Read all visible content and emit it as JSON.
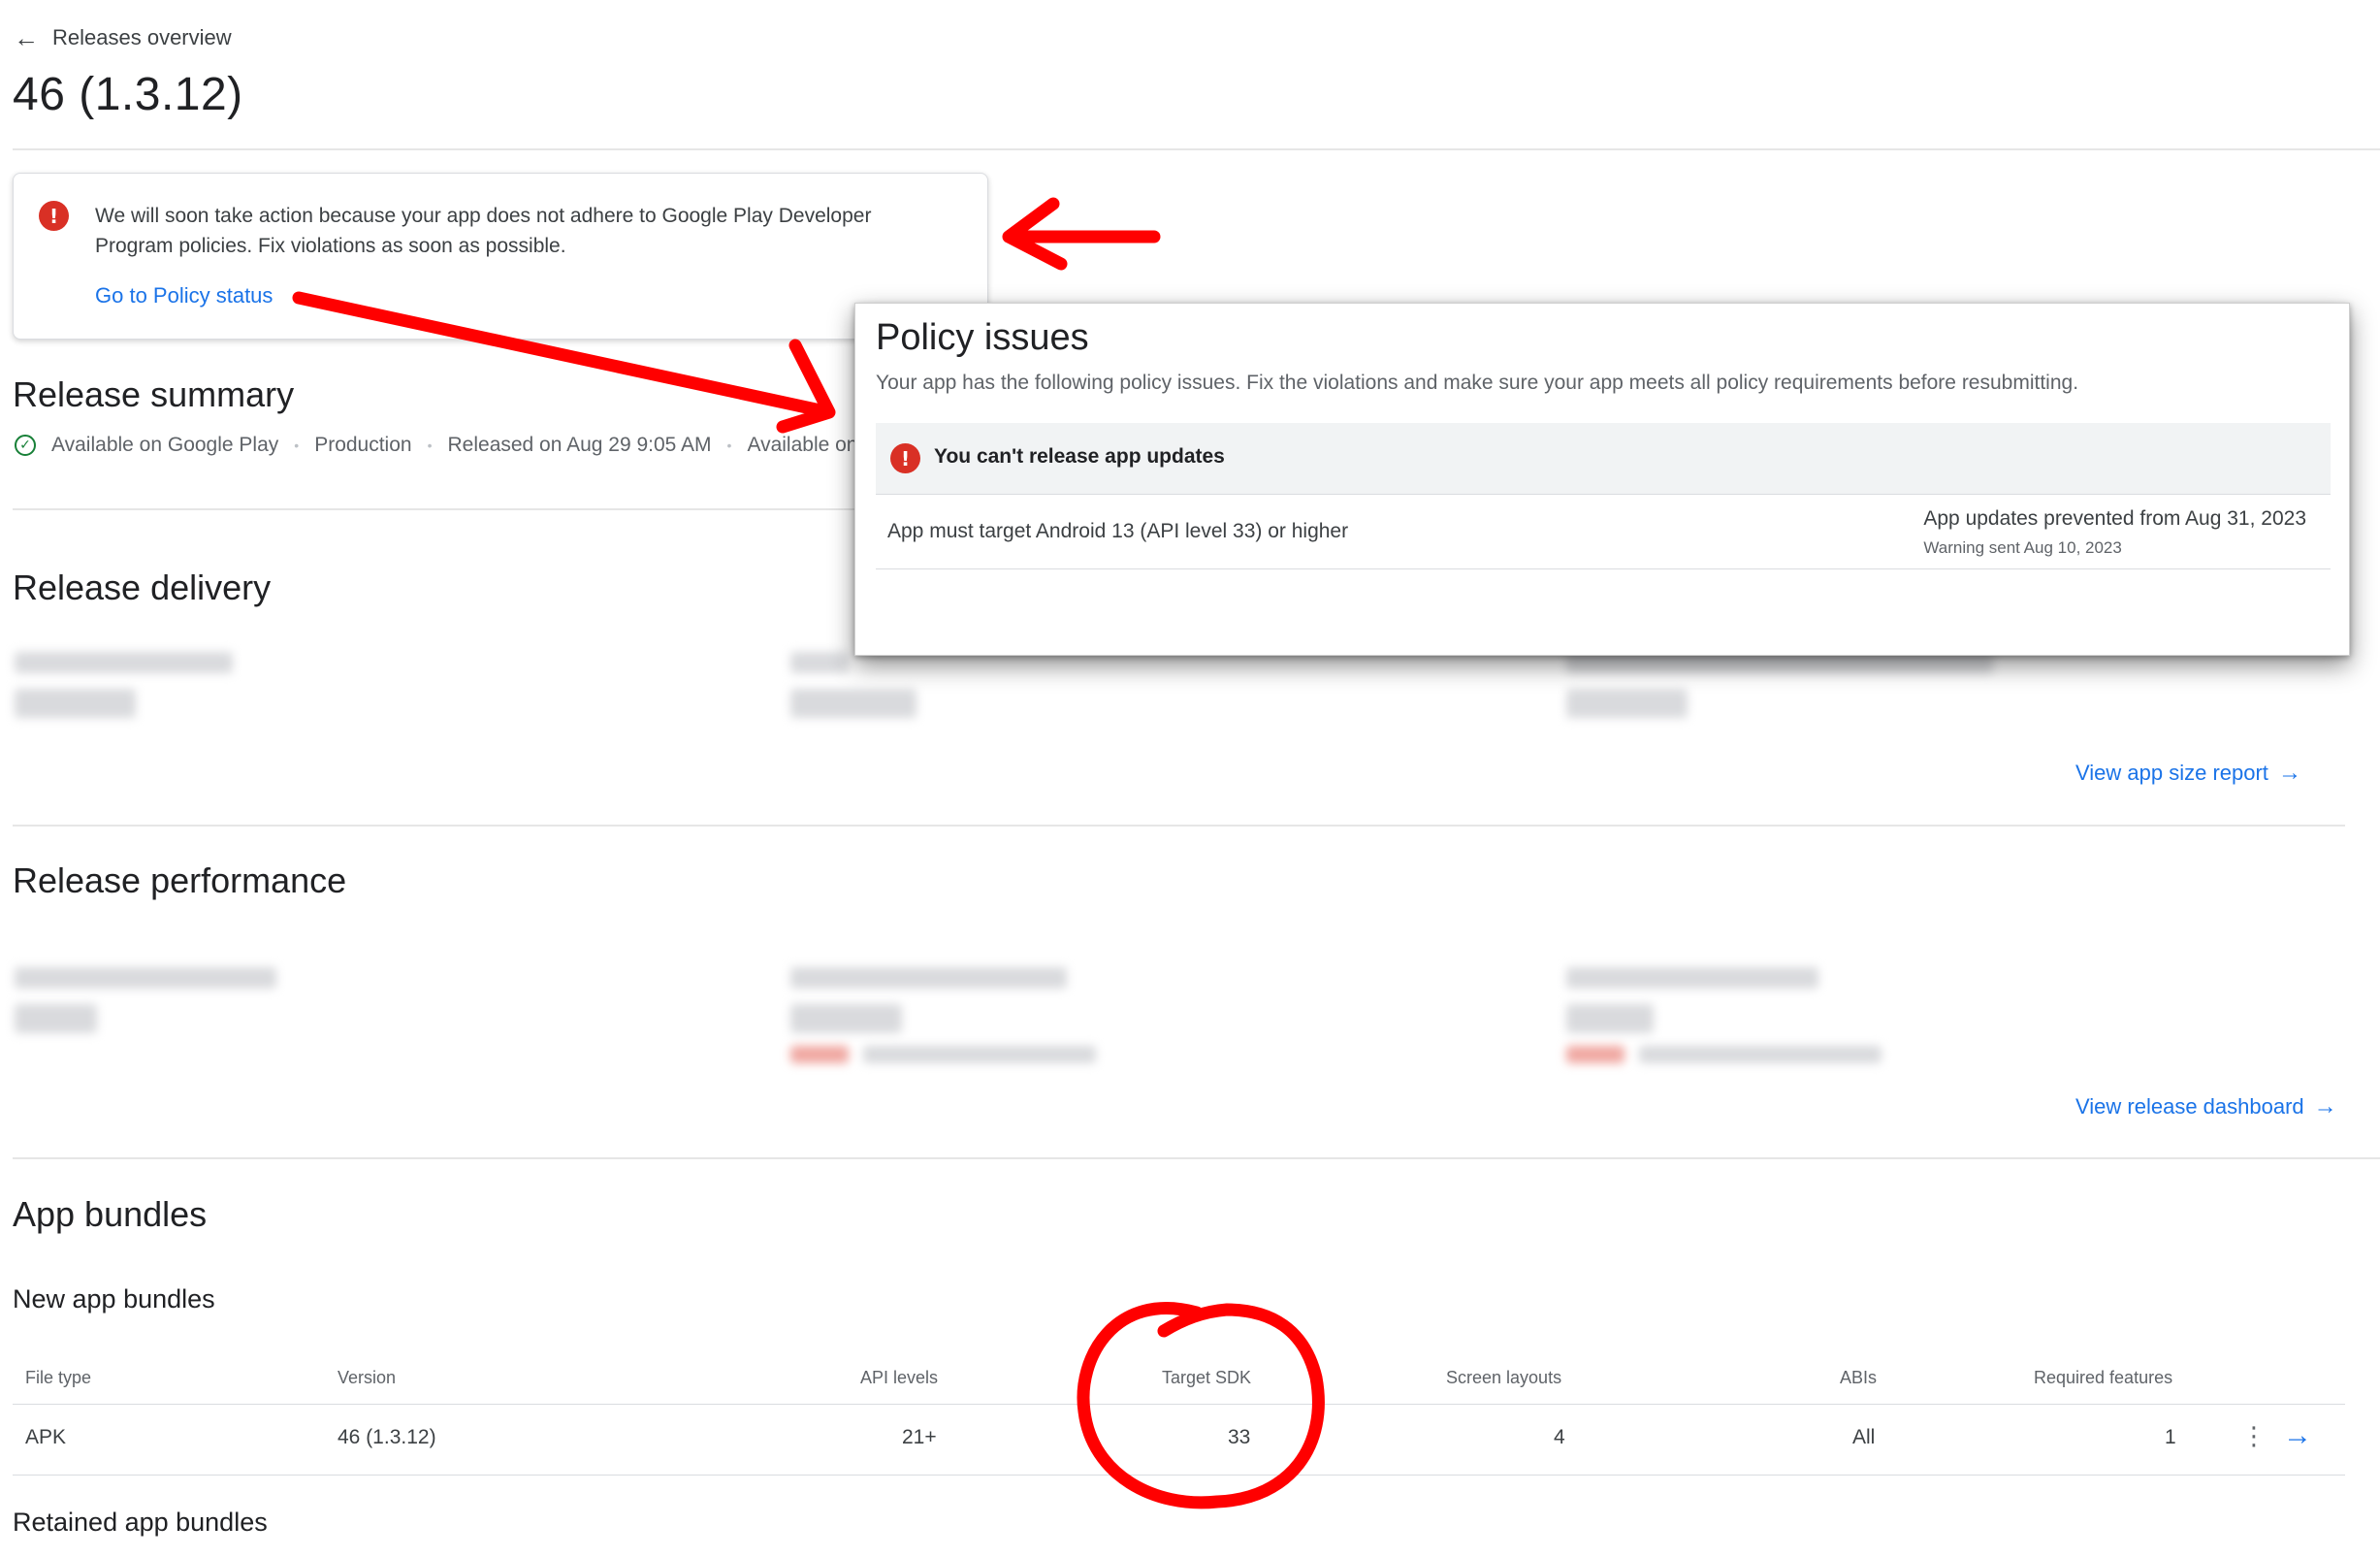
{
  "header": {
    "back_label": "Releases overview",
    "title": "46 (1.3.12)"
  },
  "policy_card": {
    "message": "We will soon take action because your app does not adhere to Google Play Developer Program policies. Fix violations as soon as possible.",
    "link": "Go to Policy status"
  },
  "release_summary": {
    "heading": "Release summary",
    "items": [
      "Available on Google Play",
      "Production",
      "Released on Aug 29 9:05 AM",
      "Available on"
    ]
  },
  "release_delivery": {
    "heading": "Release delivery",
    "link": "View app size report"
  },
  "release_performance": {
    "heading": "Release performance",
    "link": "View release dashboard"
  },
  "policy_popup": {
    "title": "Policy issues",
    "description": "Your app has the following policy issues. Fix the violations and make sure your app meets all policy requirements before resubmitting.",
    "banner": "You can't release app updates",
    "issue": "App must target Android 13 (API level 33) or higher",
    "status": "App updates prevented from Aug 31, 2023",
    "warning": "Warning sent Aug 10, 2023"
  },
  "app_bundles": {
    "heading": "App bundles",
    "new_heading": "New app bundles",
    "retained_heading": "Retained app bundles",
    "columns": [
      "File type",
      "Version",
      "API levels",
      "Target SDK",
      "Screen layouts",
      "ABIs",
      "Required features"
    ],
    "row": [
      "APK",
      "46 (1.3.12)",
      "21+",
      "33",
      "4",
      "All",
      "1"
    ]
  },
  "colors": {
    "accent": "#1a73e8",
    "error": "#d93025",
    "success": "#188038",
    "annotation": "#ff0000"
  },
  "icons": [
    "back-arrow-icon",
    "error-icon",
    "check-circle-icon",
    "arrow-right-icon",
    "more-vert-icon"
  ]
}
